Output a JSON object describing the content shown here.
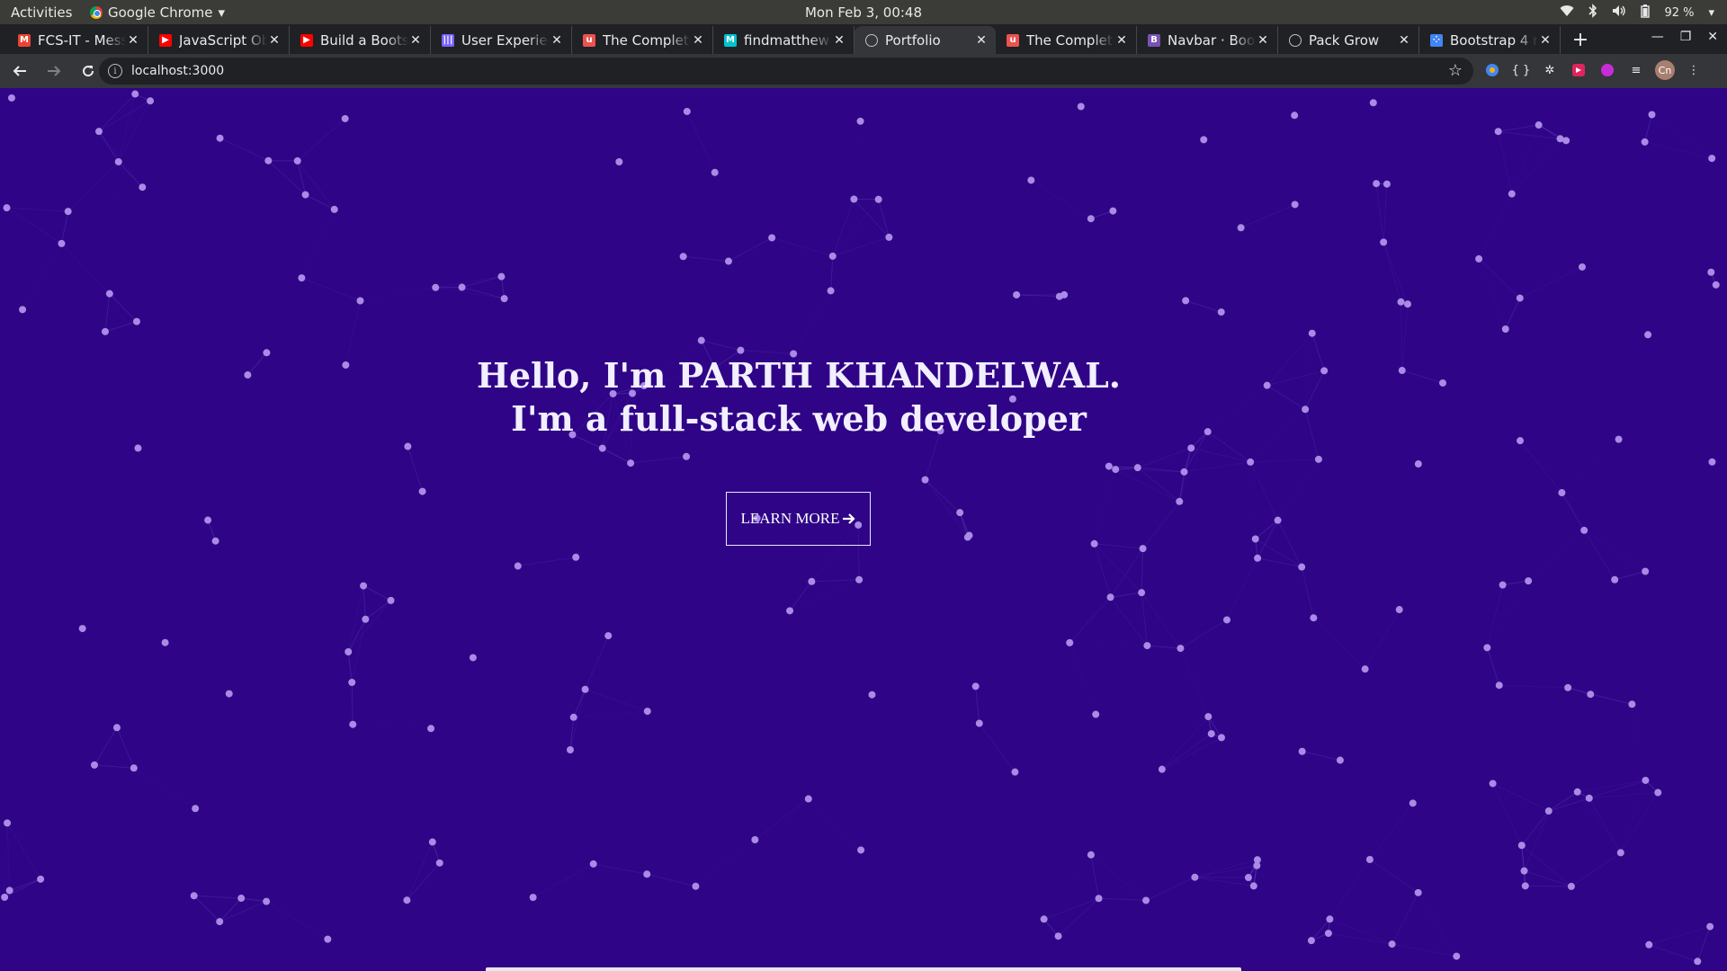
{
  "system": {
    "activities": "Activities",
    "app_menu": "Google Chrome",
    "clock": "Mon Feb  3, 00:48",
    "battery": "92 %"
  },
  "tabs": [
    {
      "title": "FCS-IT - Messe",
      "favicon": "gmail-icon",
      "color": "#ea4335",
      "active": false
    },
    {
      "title": "JavaScript Ob",
      "favicon": "youtube-icon",
      "color": "#ff0000",
      "active": false
    },
    {
      "title": "Build a Bootst",
      "favicon": "youtube-icon",
      "color": "#ff0000",
      "active": false
    },
    {
      "title": "User Experien",
      "favicon": "bars-icon",
      "color": "#7b61ff",
      "active": false
    },
    {
      "title": "The Complete",
      "favicon": "udemy-icon",
      "color": "#ec5252",
      "active": false
    },
    {
      "title": "findmatthew",
      "favicon": "m-icon",
      "color": "#00c3d0",
      "active": false
    },
    {
      "title": "Portfolio",
      "favicon": "globe-icon",
      "color": "#bdc1c6",
      "active": true
    },
    {
      "title": "The Complete",
      "favicon": "udemy-icon",
      "color": "#ec5252",
      "active": false
    },
    {
      "title": "Navbar · Boot",
      "favicon": "bootstrap-icon",
      "color": "#7952b3",
      "active": false
    },
    {
      "title": "Pack Grow",
      "favicon": "globe-icon",
      "color": "#bdc1c6",
      "active": false
    },
    {
      "title": "Bootstrap 4 n",
      "favicon": "dots-icon",
      "color": "#4285f4",
      "active": false
    }
  ],
  "toolbar": {
    "url": "localhost:3000",
    "profile_initials": "Cn"
  },
  "hero": {
    "line1": "Hello, I'm PARTH KHANDELWAL.",
    "line2": "I'm a full-stack web developer",
    "button_label": "LEARN MORE",
    "button_icon": "arrow-right-icon"
  },
  "colors": {
    "background": "#2f0487",
    "particle": "#a98ae6",
    "link": "#6a45c2"
  }
}
